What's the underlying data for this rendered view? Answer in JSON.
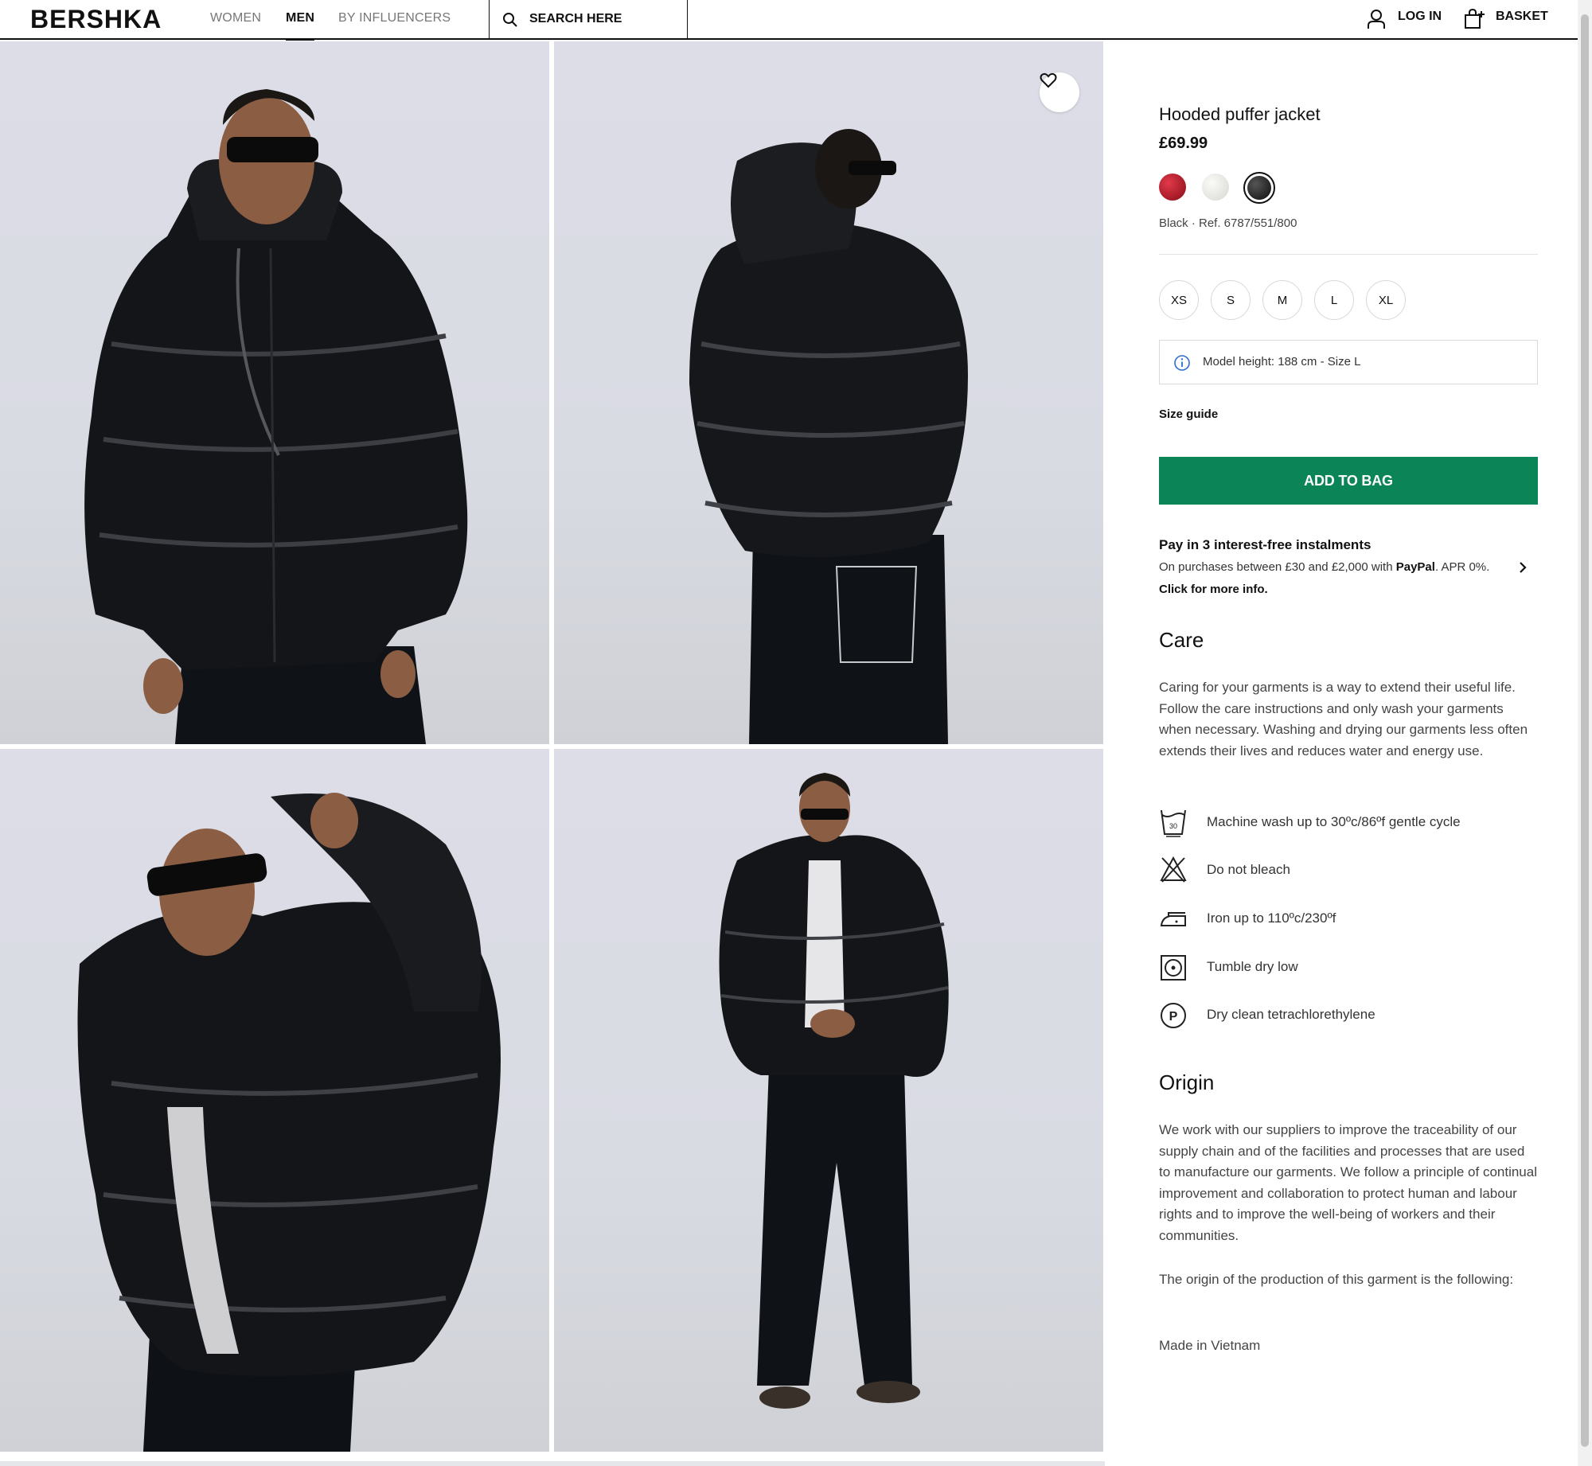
{
  "header": {
    "logo": "BERSHKA",
    "nav": [
      "WOMEN",
      "MEN",
      "BY INFLUENCERS"
    ],
    "active_nav": "MEN",
    "search_label": "SEARCH HERE",
    "login_label": "LOG IN",
    "basket_label": "BASKET"
  },
  "gallery": {
    "photos": [
      "model-front-view",
      "model-back-view",
      "model-hood-pose",
      "model-full-length"
    ],
    "favorite_icon": "heart-icon"
  },
  "product": {
    "title": "Hooded puffer jacket",
    "price": "£69.99",
    "colors": [
      {
        "name": "red",
        "hex": "#b3121f"
      },
      {
        "name": "white",
        "hex": "#e8e8e4"
      },
      {
        "name": "black",
        "hex": "#1a1a1a",
        "selected": true
      }
    ],
    "color_ref": "Black · Ref. 6787/551/800",
    "sizes": [
      "XS",
      "S",
      "M",
      "L",
      "XL"
    ],
    "model_info": "Model height: 188 cm - Size L",
    "size_guide": "Size guide",
    "add_to_bag": "ADD TO BAG",
    "accent_color": "#0b8457"
  },
  "payment": {
    "title": "Pay in 3 interest-free instalments",
    "line_before": "On purchases between £30 and £2,000 with ",
    "paypal": "PayPal",
    "line_after": ". APR 0%.",
    "more": "Click for more info."
  },
  "care": {
    "heading": "Care",
    "text": "Caring for your garments is a way to extend their useful life. Follow the care instructions and only wash your garments when necessary. Washing and drying our garments less often extends their lives and reduces water and energy use.",
    "items": [
      {
        "icon": "wash-30-icon",
        "label": "Machine wash up to 30ºc/86ºf gentle cycle"
      },
      {
        "icon": "no-bleach-icon",
        "label": "Do not bleach"
      },
      {
        "icon": "iron-icon",
        "label": "Iron up to 110ºc/230ºf"
      },
      {
        "icon": "tumble-dry-icon",
        "label": "Tumble dry low"
      },
      {
        "icon": "dry-clean-p-icon",
        "label": "Dry clean tetrachlorethylene"
      }
    ]
  },
  "origin": {
    "heading": "Origin",
    "text": "We work with our suppliers to improve the traceability of our supply chain and of the facilities and processes that are used to manufacture our garments. We follow a principle of continual improvement and collaboration to protect human and labour rights and to improve the well-being of workers and their communities.",
    "text2": "The origin of the production of this garment is the following:",
    "made_in": "Made in Vietnam"
  }
}
